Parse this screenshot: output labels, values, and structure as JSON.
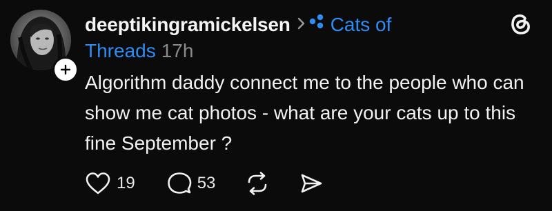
{
  "post": {
    "author": "deeptikingramickelsen",
    "community": "Cats of Threads",
    "timestamp": "17h",
    "text": "Algorithm daddy connect me to the people who can show me cat photos - what are your cats up to this fine September ?",
    "likes": "19",
    "replies": "53"
  },
  "icons": {
    "follow": "plus-icon",
    "separator": "chevron-right-icon",
    "community": "community-dots-icon",
    "app": "threads-logo-icon",
    "like": "heart-icon",
    "reply": "comment-bubble-icon",
    "repost": "repost-icon",
    "share": "send-icon"
  },
  "colors": {
    "background": "#0b0b0b",
    "text": "#f2f2f2",
    "link": "#2f8cf5",
    "muted": "#8a8a8a"
  }
}
